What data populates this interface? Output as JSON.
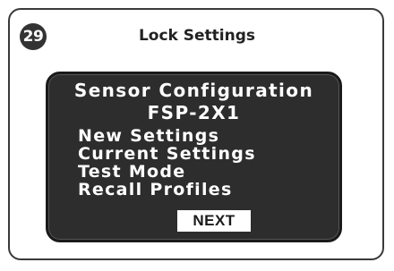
{
  "step": {
    "number": "29"
  },
  "header": {
    "title": "Lock Settings"
  },
  "screen": {
    "title": "Sensor Configuration",
    "model": "FSP-2X1",
    "menu_items": [
      {
        "label": "New Settings"
      },
      {
        "label": "Current Settings"
      },
      {
        "label": "Test Mode"
      },
      {
        "label": "Recall Profiles"
      }
    ],
    "next_label": "NEXT"
  },
  "colors": {
    "screen_background": "#2d2d2d",
    "screen_text": "#ffffff",
    "badge_background": "#333333",
    "button_background": "#ffffff"
  }
}
